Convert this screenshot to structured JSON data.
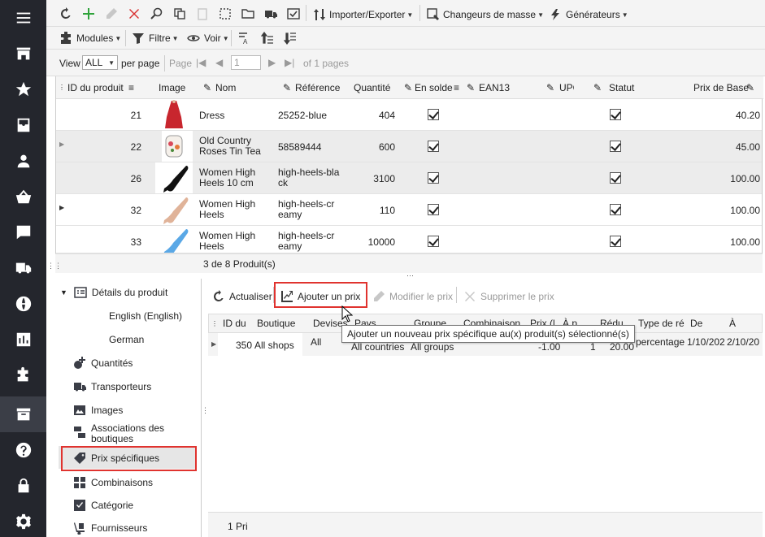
{
  "rail": {
    "items": [
      "menu-icon",
      "store-icon",
      "star-icon",
      "inbox-icon",
      "user-icon",
      "basket-icon",
      "chat-icon",
      "truck-icon",
      "globe-icon",
      "bar-chart-icon",
      "puzzle-icon",
      "box-icon",
      "help-icon",
      "lock-icon",
      "settings-icon"
    ]
  },
  "toolbar": {
    "import_export": "Importer/Exporter",
    "mass_changers": "Changeurs de masse",
    "generators": "Générateurs",
    "modules": "Modules",
    "filter": "Filtre",
    "view": "Voir"
  },
  "pager": {
    "view_label": "View",
    "per_page_value": "ALL",
    "per_page_label": "per page",
    "page_label": "Page",
    "page_value": "1",
    "of_pages": "of 1 pages"
  },
  "grid": {
    "columns": [
      "ID du produit",
      "Image",
      "Nom",
      "Référence",
      "Quantité",
      "En solde",
      "EAN13",
      "UPC",
      "Statut",
      "Prix de Base"
    ],
    "rows": [
      {
        "id": "21",
        "name": "Dress",
        "ref": "25252-blue",
        "qty": "404",
        "price": "40.20"
      },
      {
        "id": "22",
        "name": "Old Country Roses Tin Tea",
        "ref": "58589444",
        "qty": "600",
        "price": "45.00"
      },
      {
        "id": "26",
        "name": "Women High Heels 10 cm",
        "ref": "high-heels-black",
        "qty": "3100",
        "price": "100.00"
      },
      {
        "id": "32",
        "name": "Women High Heels",
        "ref": "high-heels-creamy",
        "qty": "110",
        "price": "100.00"
      },
      {
        "id": "33",
        "name": "Women High Heels",
        "ref": "high-heels-creamy",
        "qty": "10000",
        "price": "100.00"
      }
    ],
    "count": "3 de 8 Produit(s)"
  },
  "tree": {
    "items": [
      {
        "label": "Détails du produit"
      },
      {
        "label": "English (English)"
      },
      {
        "label": "German"
      },
      {
        "label": "Quantités"
      },
      {
        "label": "Transporteurs"
      },
      {
        "label": "Images"
      },
      {
        "label": "Associations des boutiques"
      },
      {
        "label": "Prix spécifiques"
      },
      {
        "label": "Combinaisons"
      },
      {
        "label": "Catégorie"
      },
      {
        "label": "Fournisseurs"
      }
    ]
  },
  "panel": {
    "refresh": "Actualiser",
    "add_price": "Ajouter un prix",
    "edit_price": "Modifier le prix",
    "delete_price": "Supprimer le prix",
    "columns": [
      "ID du",
      "Boutique",
      "Devises",
      "Pays",
      "Groupe",
      "Combinaison",
      "Prix (l",
      "À p",
      "Rédu",
      "Type de ré",
      "De",
      "À"
    ],
    "row": {
      "id": "350",
      "shop": "All shops",
      "currency": "All",
      "country": "All countries",
      "group": "All groups",
      "price": "-1.00",
      "from_qty": "1",
      "reduction": "20.00",
      "type": "percentage",
      "from": "1/10/202",
      "to": "2/10/20"
    },
    "footer": "1 Pri"
  },
  "tooltip": "Ajouter un nouveau prix spécifique au(x) produit(s) sélectionné(s)",
  "colors": {
    "rail": "#24262d",
    "highlight": "#e0332f",
    "toolbar": "#f4f4f4"
  }
}
